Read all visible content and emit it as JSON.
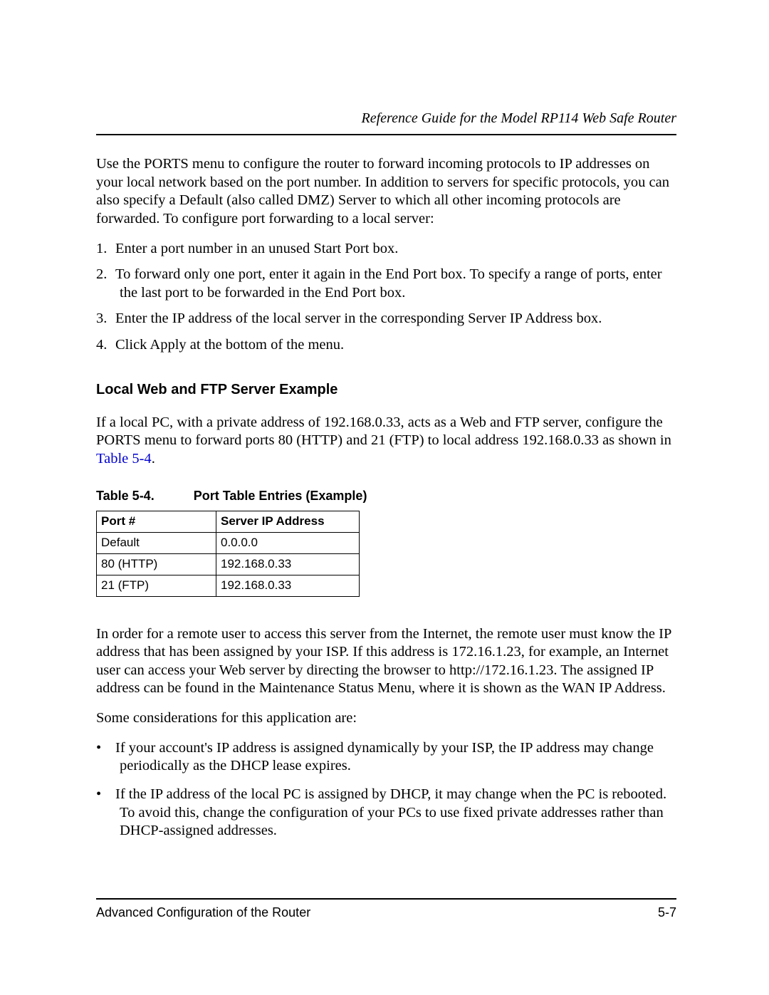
{
  "header": {
    "running_title": "Reference Guide for the Model RP114 Web Safe Router"
  },
  "intro_paragraph": "Use the PORTS menu to configure the router to forward incoming protocols to IP addresses on your local network based on the port number. In addition to servers for specific protocols, you can also specify a Default (also called DMZ) Server to which all other incoming protocols are forwarded. To configure port forwarding to a local server:",
  "steps": [
    "Enter a port number in an unused Start Port box.",
    "To forward only one port, enter it again in the End Port box. To specify a range of ports, enter the last port to be forwarded in the End Port box.",
    "Enter the IP address of the local server in the corresponding Server IP Address box.",
    "Click Apply at the bottom of the menu."
  ],
  "section_heading": "Local Web and FTP Server Example",
  "example_para_prefix": "If a local PC, with a private address of 192.168.0.33, acts as a Web and FTP server, configure the PORTS menu to forward ports 80 (HTTP) and 21 (FTP) to local address 192.168.0.33 as shown in ",
  "example_para_link": "Table 5-4",
  "example_para_suffix": ".",
  "table": {
    "caption_label": "Table 5-4.",
    "caption_title": "Port Table Entries (Example)",
    "headers": {
      "col1": "Port #",
      "col2": "Server IP Address"
    },
    "rows": [
      {
        "port": "Default",
        "ip": "0.0.0.0"
      },
      {
        "port": "80 (HTTP)",
        "ip": "192.168.0.33"
      },
      {
        "port": "21 (FTP)",
        "ip": "192.168.0.33"
      }
    ]
  },
  "after_table_para": "In order for a remote user to access this server from the Internet, the remote user must know the IP address that has been assigned by your ISP. If this address is 172.16.1.23, for example, an Internet user can access your Web server by directing the browser to http://172.16.1.23. The assigned IP address can be found in the Maintenance Status Menu, where it is shown as the WAN IP Address.",
  "considerations_intro": "Some considerations for this application are:",
  "considerations": [
    "If your account's IP address is assigned dynamically by your ISP, the IP address may change periodically as the DHCP lease expires.",
    "If the IP address of the local PC is assigned by DHCP, it may change when the PC is rebooted. To avoid this, change the configuration of your PCs to use fixed private addresses rather than DHCP-assigned addresses."
  ],
  "footer": {
    "left": "Advanced Configuration of the Router",
    "right": "5-7"
  }
}
